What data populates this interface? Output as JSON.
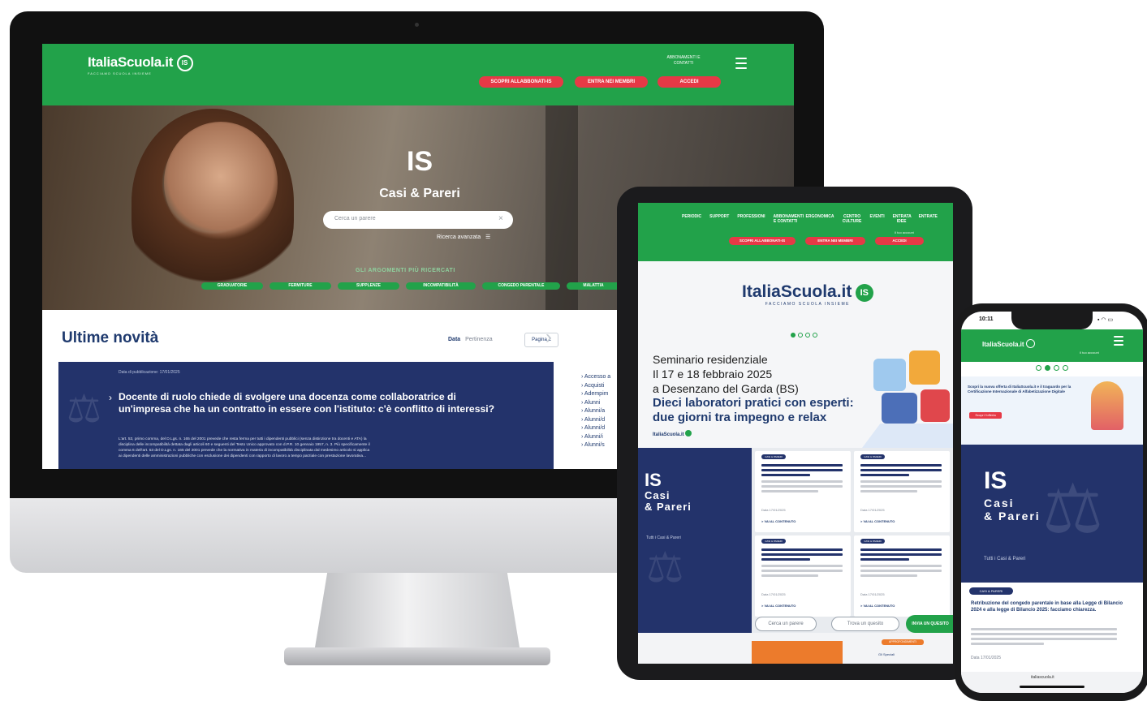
{
  "desktop": {
    "brand": "ItaliaScuola.it",
    "brand_badge": "IS",
    "tagline": "FACCIAMO SCUOLA INSIEME",
    "header_link": "ABBONAMENTI E CONTATTI",
    "buttons": [
      "SCOPRI ALLABBONATI-IS",
      "ENTRA NEI MEMBRI",
      "ACCEDI"
    ],
    "hero_title": "IS",
    "hero_subtitle": "Casi & Pareri",
    "search_placeholder": "Cerca un parere",
    "advanced_search": "Ricerca avanzata",
    "topics_title": "GLI ARGOMENTI PIÙ RICERCATI",
    "topics": [
      "GRADUATORIE",
      "FERMITURE",
      "SUPPLENZE",
      "INCOMPATIBILITÀ",
      "CONGEDO PARENTALE",
      "MALATTIA"
    ],
    "section_title": "Ultime novità",
    "sort_label": "Data",
    "sort_alt": "Pertinenza",
    "page_label": "Pagina 1",
    "article": {
      "date": "Data di pubblicazione: 17/01/2025",
      "title": "Docente di ruolo chiede di svolgere una docenza come collaboratrice di un'impresa che ha un contratto in essere con l'istituto: c'è conflitto di interessi?",
      "body_1": "L'art. 53, primo comma, del D.Lgs. n. 165 del 2001 prevede che resta ferma per tutti i dipendenti pubblici (senza distinzione tra docenti e ATA) la",
      "body_2": "disciplina delle incompatibilità dettata dagli articoli 60 e seguenti del Testo Unico approvato con d.P.R. 10 gennaio 1957, n. 3. Più specificamente il",
      "body_3": "comma 6 dell'art. 53 del D.Lgs. n. 165 del 2001 prevede che la normativa in materia di incompatibilità disciplinata dal medesimo articolo si applica",
      "body_4": "ai dipendenti delle amministrazioni pubbliche con esclusione dei dipendenti con rapporto di lavoro a tempo parziale con prestazione lavorativa..."
    },
    "sidebar_items": [
      "Accesso a",
      "Acquisti",
      "Adempim",
      "Alunni",
      "Alunni/a",
      "Alunni/d",
      "Alunni/d",
      "Alunni/i",
      "Alunni/s"
    ]
  },
  "tablet": {
    "nav": [
      "PERIODIC",
      "SUPPORT",
      "PROFESSIONI",
      "ABBONAMENTI E CONTATTI",
      "ERGONOMICA",
      "CENTRO CULTURE",
      "EVENTI",
      "ENTRATA IDEE",
      "ENTRATE"
    ],
    "account_hint": "Il tuo account",
    "buttons": [
      "SCOPRI ALLABBONATI-IS",
      "ENTRA NEI MEMBRI",
      "ACCEDI"
    ],
    "brand": "ItaliaScuola.it",
    "brand_badge": "IS",
    "tagline": "FACCIAMO SCUOLA INSIEME",
    "seminar_line1": "Seminario residenziale",
    "seminar_line2": "Il 17 e 18 febbraio 2025",
    "seminar_line3": "a Desenzano del Garda (BS)",
    "seminar_bold1": "Dieci laboratori pratici con esperti:",
    "seminar_bold2": "due giorni tra impegno e relax",
    "small_brand": "ItaliaScuola.it",
    "casi_title_1": "IS",
    "casi_title_2": "Casi",
    "casi_title_3": "& Pareri",
    "casi_link": "Tutti i Casi & Pareri",
    "card_tag": "CASI & PARERI",
    "card_date": "Data 17/01/2025",
    "card_link": "> VAI AL CONTENUTO",
    "search_pill": "Cerca un parere",
    "search_pill_2": "Trova un quesito",
    "cta": "INVIA UN QUESITO",
    "badge_orange": "APPROFONDIMENTI",
    "footer_hint": "Gli Speciali"
  },
  "phone": {
    "time": "10:11",
    "brand": "ItaliaScuola.it",
    "account": "Il tuo account",
    "banner_text": "Scopri la nuova offerta di ItaliaScuola.it e il traguardo per la Certificazione Internazionale di Alfabetizzazione Digitale",
    "banner_btn": "Scopri l'offerta",
    "casi_1": "IS",
    "casi_2": "Casi",
    "casi_3": "& Pareri",
    "casi_link": "Tutti i Casi & Pareri",
    "card_tag": "CASI & PARERI",
    "card_title": "Retribuzione del congedo parentale in base alla Legge di Bilancio 2024 e alla legge di Bilancio 2025: facciamo chiarezza.",
    "card_date": "Data 17/01/2025",
    "url": "italiascuola.it"
  }
}
